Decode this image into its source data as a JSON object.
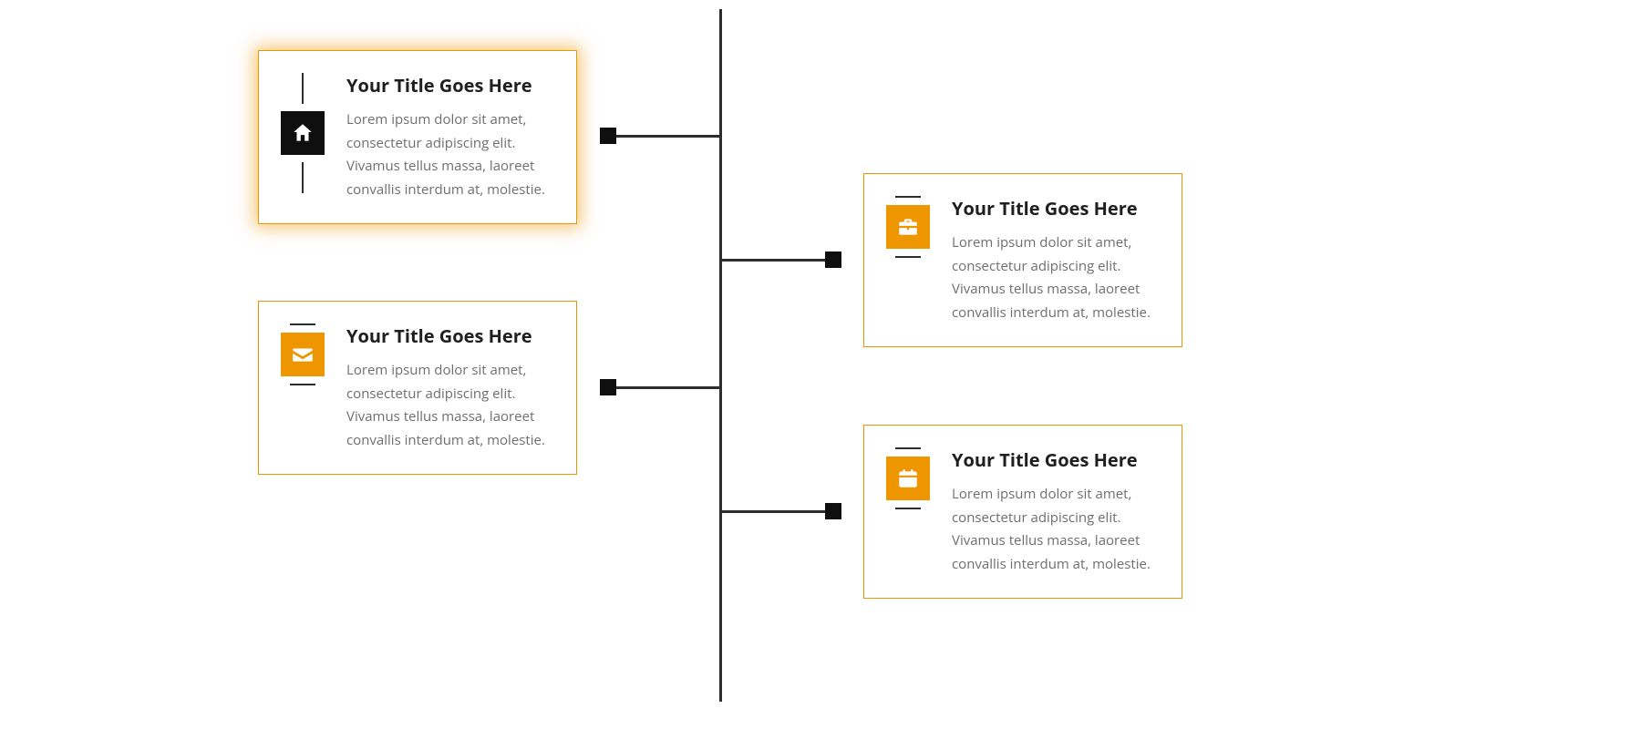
{
  "colors": {
    "accent": "#ed9600",
    "axis": "#2d2d2d"
  },
  "items": [
    {
      "title": "Your Title Goes Here",
      "body": "Lorem ipsum dolor sit amet, consectetur adipiscing elit. Vivamus tellus massa, laoreet convallis interdum at, molestie.",
      "icon": "home-icon",
      "side": "left",
      "highlighted": true
    },
    {
      "title": "Your Title Goes Here",
      "body": "Lorem ipsum dolor sit amet, consectetur adipiscing elit. Vivamus tellus massa, laoreet convallis interdum at, molestie.",
      "icon": "briefcase-icon",
      "side": "right",
      "highlighted": false
    },
    {
      "title": "Your Title Goes Here",
      "body": "Lorem ipsum dolor sit amet, consectetur adipiscing elit. Vivamus tellus massa, laoreet convallis interdum at, molestie.",
      "icon": "mail-icon",
      "side": "left",
      "highlighted": false
    },
    {
      "title": "Your Title Goes Here",
      "body": "Lorem ipsum dolor sit amet, consectetur adipiscing elit. Vivamus tellus massa, laoreet convallis interdum at, molestie.",
      "icon": "calendar-icon",
      "side": "right",
      "highlighted": false
    }
  ]
}
